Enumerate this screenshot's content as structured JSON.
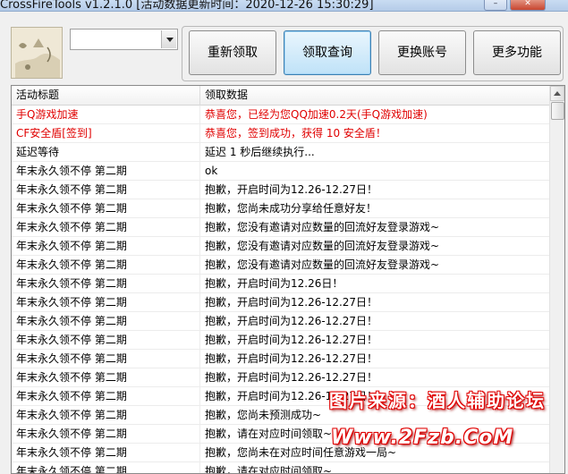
{
  "window": {
    "title": "CrossFireTools v1.2.1.0 [活动数据更新时间：2020-12-26 15:30:29]",
    "minimize_glyph": "–",
    "close_glyph": "✕"
  },
  "account": {
    "selected": ""
  },
  "toolbar": {
    "buttons": [
      "重新领取",
      "领取查询",
      "更换账号",
      "更多功能"
    ]
  },
  "list": {
    "headers": [
      "活动标题",
      "领取数据"
    ],
    "rows": [
      {
        "title": "手Q游戏加速",
        "data": "恭喜您，已经为您QQ加速0.2天(手Q游戏加速)",
        "highlight": true
      },
      {
        "title": "CF安全盾[签到]",
        "data": "恭喜您，签到成功，获得 10 安全盾！",
        "highlight": true
      },
      {
        "title": "延迟等待",
        "data": "延迟 1 秒后继续执行...",
        "highlight": false
      },
      {
        "title": "年末永久领不停 第二期",
        "data": "ok",
        "highlight": false
      },
      {
        "title": "年末永久领不停 第二期",
        "data": "抱歉，开启时间为12.26-12.27日！",
        "highlight": false
      },
      {
        "title": "年末永久领不停 第二期",
        "data": "抱歉，您尚未成功分享给任意好友！",
        "highlight": false
      },
      {
        "title": "年末永久领不停 第二期",
        "data": "抱歉，您没有邀请对应数量的回流好友登录游戏~",
        "highlight": false
      },
      {
        "title": "年末永久领不停 第二期",
        "data": "抱歉，您没有邀请对应数量的回流好友登录游戏~",
        "highlight": false
      },
      {
        "title": "年末永久领不停 第二期",
        "data": "抱歉，您没有邀请对应数量的回流好友登录游戏~",
        "highlight": false
      },
      {
        "title": "年末永久领不停 第二期",
        "data": "抱歉，开启时间为12.26日！",
        "highlight": false
      },
      {
        "title": "年末永久领不停 第二期",
        "data": "抱歉，开启时间为12.26-12.27日！",
        "highlight": false
      },
      {
        "title": "年末永久领不停 第二期",
        "data": "抱歉，开启时间为12.26-12.27日！",
        "highlight": false
      },
      {
        "title": "年末永久领不停 第二期",
        "data": "抱歉，开启时间为12.26-12.27日！",
        "highlight": false
      },
      {
        "title": "年末永久领不停 第二期",
        "data": "抱歉，开启时间为12.26-12.27日！",
        "highlight": false
      },
      {
        "title": "年末永久领不停 第二期",
        "data": "抱歉，开启时间为12.26-12.27日！",
        "highlight": false
      },
      {
        "title": "年末永久领不停 第二期",
        "data": "抱歉，开启时间为12.26-12.27日！",
        "highlight": false
      },
      {
        "title": "年末永久领不停 第二期",
        "data": "抱歉，您尚未预测成功~",
        "highlight": false
      },
      {
        "title": "年末永久领不停 第二期",
        "data": "抱歉，请在对应时间领取~",
        "highlight": false
      },
      {
        "title": "年末永久领不停 第二期",
        "data": "抱歉，您尚未在对应时间任意游戏一局~",
        "highlight": false
      },
      {
        "title": "年末永久领不停 第二期",
        "data": "抱歉，请在对应时间领取~",
        "highlight": false
      }
    ]
  },
  "watermark": {
    "line1": "图片来源：酒人辅助论坛",
    "line2": "Www.2Fzb.CoM"
  },
  "colors": {
    "highlight_text": "#e00000",
    "active_button_border": "#3c7fb1"
  }
}
